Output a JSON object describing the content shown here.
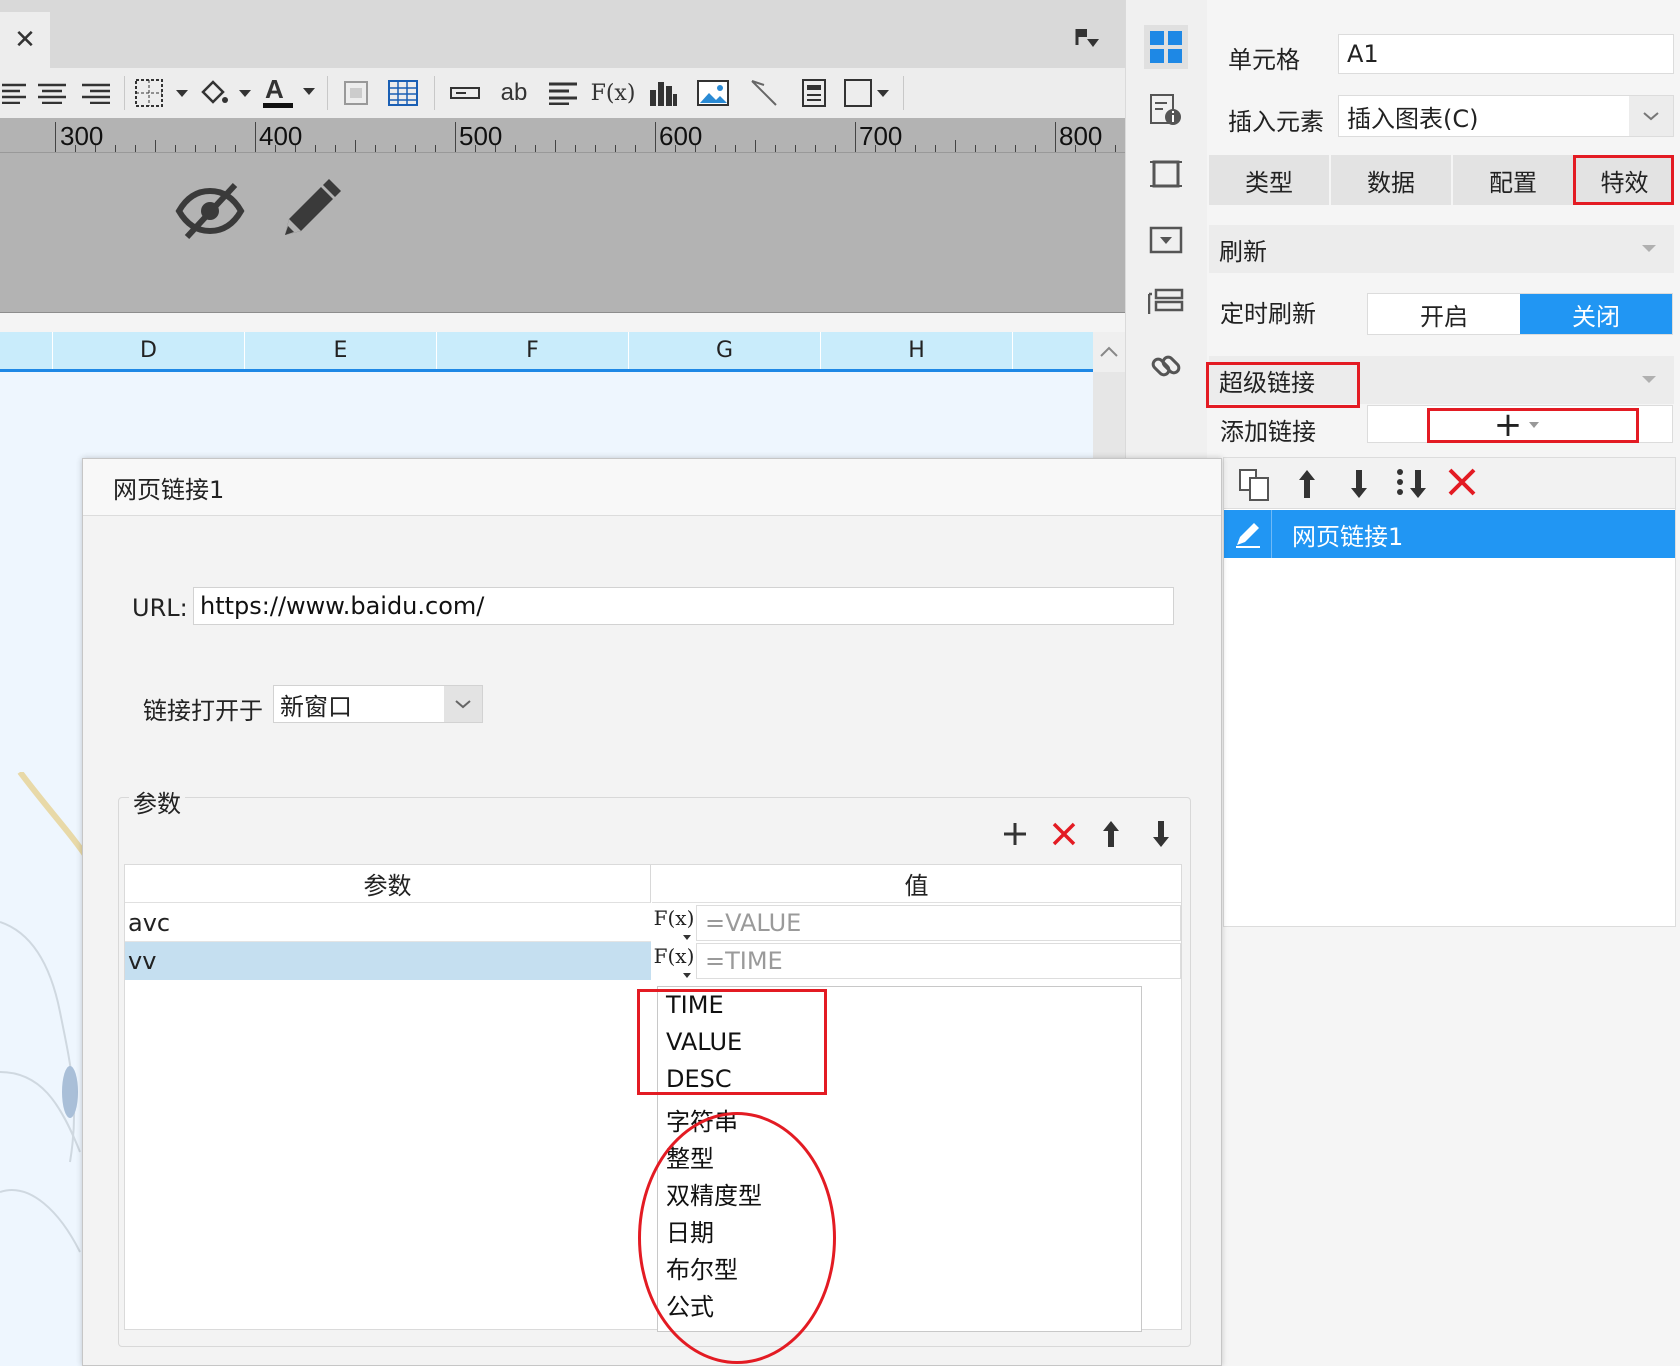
{
  "editor": {
    "close_glyph": "✕",
    "toolbar_text_ab": "ab",
    "toolbar_text_fx": "F(x)",
    "ruler_labels": [
      "300",
      "400",
      "500",
      "600",
      "700",
      "800"
    ],
    "columns": [
      "D",
      "E",
      "F",
      "G",
      "H"
    ]
  },
  "right_panel": {
    "cell_label": "单元格",
    "cell_value": "A1",
    "insert_label": "插入元素",
    "insert_value": "插入图表(C)",
    "tabs": [
      "类型",
      "数据",
      "配置",
      "特效"
    ],
    "refresh_section": "刷新",
    "timer_refresh_label": "定时刷新",
    "toggle_on": "开启",
    "toggle_off": "关闭",
    "hyperlink_section": "超级链接",
    "add_link_label": "添加链接",
    "add_link_button": "+",
    "link_item": "网页链接1"
  },
  "dialog": {
    "title": "网页链接1",
    "url_label": "URL:",
    "url_value": "https://www.baidu.com/",
    "open_in_label": "链接打开于",
    "open_in_value": "新窗口",
    "params_group": "参数",
    "col_param": "参数",
    "col_value": "值",
    "rows": [
      {
        "param": "avc",
        "value": "=VALUE"
      },
      {
        "param": "vv",
        "value": "=TIME"
      }
    ],
    "fx_label": "F(x)",
    "dropdown_options": [
      "TIME",
      "VALUE",
      "DESC",
      "字符串",
      "整型",
      "双精度型",
      "日期",
      "布尔型",
      "公式"
    ]
  },
  "colors": {
    "accent": "#2196f3",
    "highlight_red": "#e31b23",
    "column_header": "#c9ecfb",
    "selected_row": "#c5dff0"
  }
}
